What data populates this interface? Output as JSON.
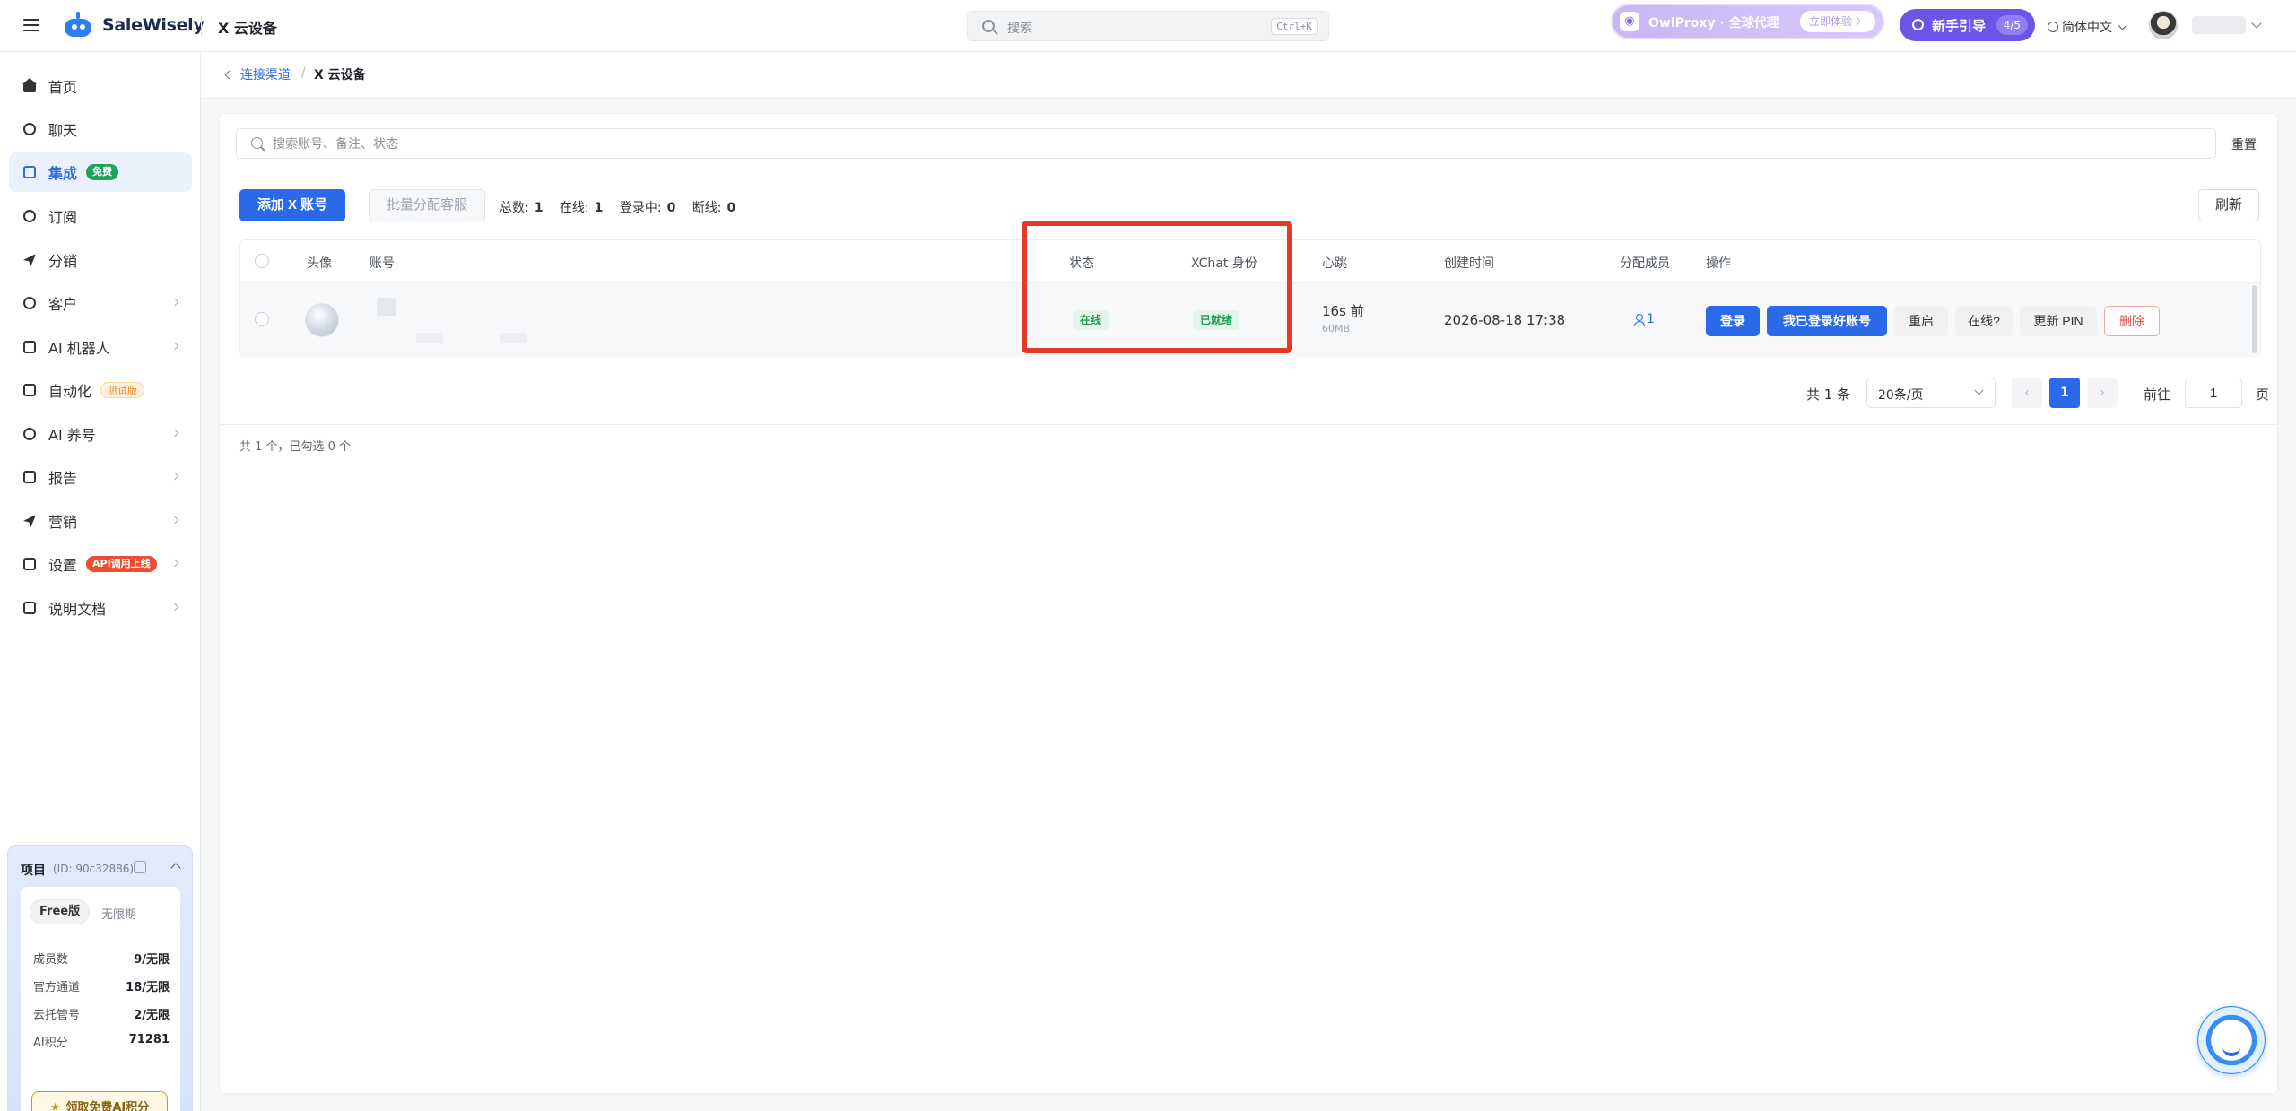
{
  "header": {
    "brand": "SaleWisely",
    "page_title": "X 云设备",
    "search_placeholder": "搜索",
    "search_shortcut": "Ctrl+K",
    "promo_text": "OwlProxy · 全球代理",
    "promo_cta": "立即体验 〉",
    "guide_label": "新手引导",
    "guide_progress": "4/5",
    "language": "简体中文"
  },
  "sidebar": {
    "items": [
      {
        "label": "首页",
        "icon": "home-icon"
      },
      {
        "label": "聊天",
        "icon": "chat-icon"
      },
      {
        "label": "集成",
        "icon": "integration-icon",
        "badge": "免费",
        "active": true
      },
      {
        "label": "订阅",
        "icon": "database-icon"
      },
      {
        "label": "分销",
        "icon": "send-icon"
      },
      {
        "label": "客户",
        "icon": "user-icon"
      },
      {
        "label": "AI 机器人",
        "icon": "robot-icon"
      },
      {
        "label": "自动化",
        "icon": "automation-icon",
        "badge": "测试版"
      },
      {
        "label": "AI 养号",
        "icon": "sun-icon"
      },
      {
        "label": "报告",
        "icon": "report-icon"
      },
      {
        "label": "营销",
        "icon": "marketing-icon"
      },
      {
        "label": "设置",
        "icon": "settings-icon",
        "badge": "API调用上线"
      },
      {
        "label": "说明文档",
        "icon": "doc-icon"
      }
    ],
    "project": {
      "title": "项目",
      "id": "(ID: 90c32886)",
      "plan": "Free版",
      "expiry": "无限期",
      "rows": [
        {
          "k": "成员数",
          "v": "9/无限"
        },
        {
          "k": "官方通道",
          "v": "18/无限"
        },
        {
          "k": "云托管号",
          "v": "2/无限"
        },
        {
          "k": "AI积分",
          "v": "71281"
        }
      ],
      "cta": "领取免费AI积分"
    }
  },
  "breadcrumb": {
    "parent": "连接渠道",
    "sep": "/",
    "current": "X 云设备"
  },
  "main": {
    "search_placeholder": "搜索账号、备注、状态",
    "reset": "重置",
    "add_button": "添加 X 账号",
    "batch_button": "批量分配客服",
    "refresh": "刷新",
    "stats": {
      "total_label": "总数:",
      "total": "1",
      "online_label": "在线:",
      "online": "1",
      "logging_label": "登录中:",
      "logging": "0",
      "offline_label": "断线:",
      "offline": "0"
    },
    "columns": [
      "头像",
      "账号",
      "状态",
      "XChat 身份",
      "心跳",
      "创建时间",
      "分配成员",
      "操作"
    ],
    "row": {
      "status": "在线",
      "xchat": "已就绪",
      "heartbeat": "16s 前",
      "memory": "60MB",
      "created": "2026-08-18 17:38",
      "members": "1",
      "actions": [
        "登录",
        "我已登录好账号",
        "重启",
        "在线?",
        "更新 PIN",
        "删除"
      ]
    },
    "pager": {
      "total": "共 1 条",
      "page_size": "20条/页",
      "prev": "‹",
      "current": "1",
      "next": "›",
      "goto": "前往",
      "goto_value": "1",
      "page_suffix": "页"
    },
    "selected_info": "共 1 个，已勾选 0 个"
  }
}
